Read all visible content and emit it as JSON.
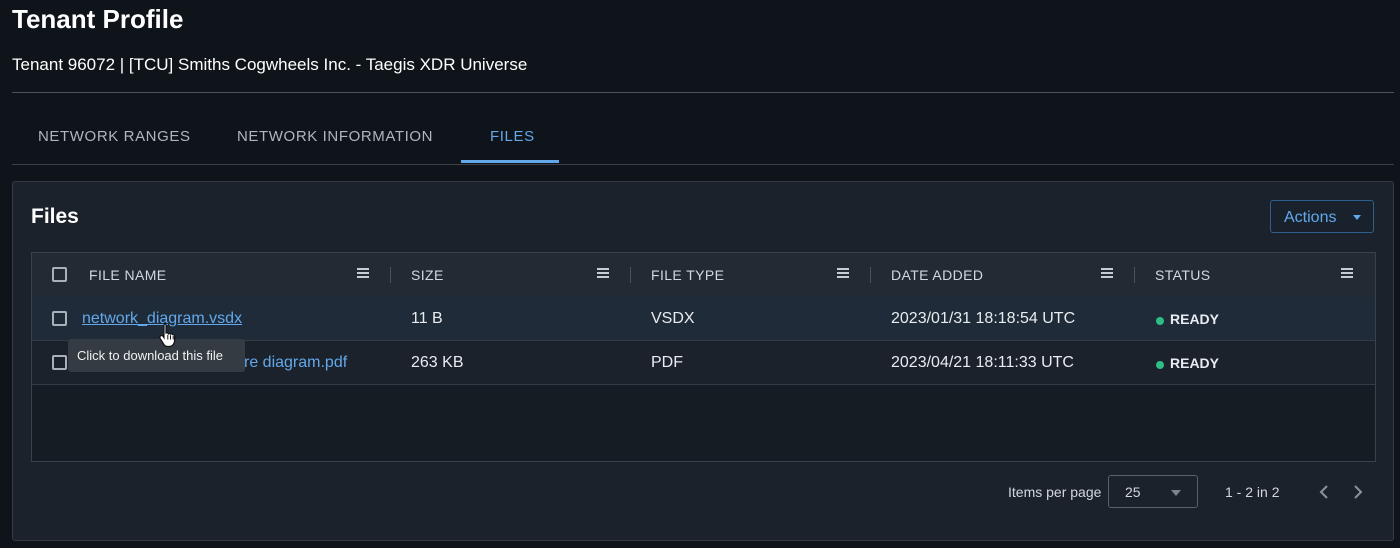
{
  "page": {
    "title": "Tenant Profile",
    "subtitle": "Tenant 96072 | [TCU] Smiths Cogwheels Inc. - Taegis XDR Universe"
  },
  "tabs": [
    {
      "label": "NETWORK RANGES",
      "active": false
    },
    {
      "label": "NETWORK INFORMATION",
      "active": false
    },
    {
      "label": "FILES",
      "active": true
    }
  ],
  "files_card": {
    "title": "Files",
    "actions_label": "Actions"
  },
  "table": {
    "columns": [
      "FILE NAME",
      "SIZE",
      "FILE TYPE",
      "DATE ADDED",
      "STATUS"
    ],
    "rows": [
      {
        "file_name": "network_diagram.vsdx",
        "size": "11 B",
        "file_type": "VSDX",
        "date_added": "2023/01/31 18:18:54 UTC",
        "status": "READY"
      },
      {
        "file_name": "re diagram.pdf",
        "size": "263 KB",
        "file_type": "PDF",
        "date_added": "2023/04/21 18:11:33 UTC",
        "status": "READY"
      }
    ]
  },
  "tooltip": {
    "text": "Click to download this file"
  },
  "pagination": {
    "items_per_page_label": "Items per page",
    "items_per_page_value": "25",
    "range_text": "1 - 2 in 2"
  },
  "colors": {
    "accent": "#62a8ea",
    "status_ready": "#2ebd85",
    "background": "#0f141a",
    "card": "#1b222b"
  },
  "icons": [
    "column-menu-icon",
    "caret-down-icon",
    "chevron-left-icon",
    "chevron-right-icon",
    "hand-cursor-icon"
  ]
}
